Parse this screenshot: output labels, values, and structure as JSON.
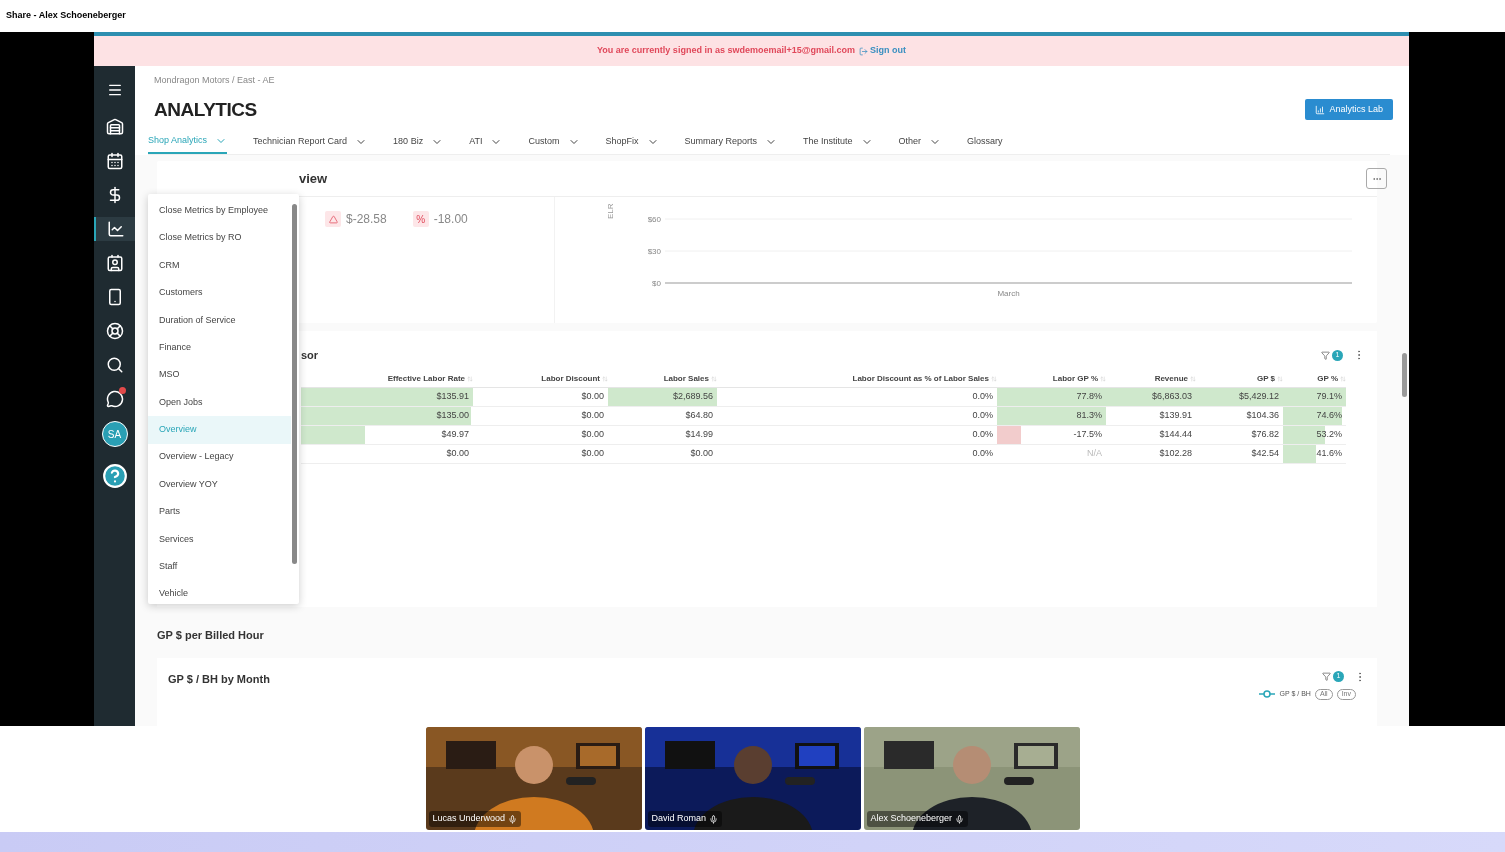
{
  "share_bar": {
    "title": "Share - Alex Schoeneberger"
  },
  "banner": {
    "message": "You are currently signed in as swdemoemail+15@gmail.com",
    "link": "Sign out"
  },
  "sidebar": {
    "items": [
      {
        "selected": false
      },
      {
        "selected": false
      },
      {
        "selected": false
      },
      {
        "selected": true
      },
      {
        "selected": false
      },
      {
        "selected": false
      },
      {
        "selected": false
      },
      {
        "selected": false
      },
      {
        "selected": false
      }
    ],
    "avatar": "SA"
  },
  "breadcrumb": "Mondragon Motors / East - AE",
  "title": "ANALYTICS",
  "lab_button": "Analytics Lab",
  "tabs": [
    {
      "label": "Shop Analytics",
      "selected": true,
      "dropdown": true
    },
    {
      "label": "Technician Report Card",
      "selected": false,
      "dropdown": true
    },
    {
      "label": "180 Biz",
      "selected": false,
      "dropdown": true
    },
    {
      "label": "ATI",
      "selected": false,
      "dropdown": true
    },
    {
      "label": "Custom",
      "selected": false,
      "dropdown": true
    },
    {
      "label": "ShopFix",
      "selected": false,
      "dropdown": true
    },
    {
      "label": "Summary Reports",
      "selected": false,
      "dropdown": true
    },
    {
      "label": "The Institute",
      "selected": false,
      "dropdown": true
    },
    {
      "label": "Other",
      "selected": false,
      "dropdown": true
    },
    {
      "label": "Glossary",
      "selected": false,
      "dropdown": false
    }
  ],
  "menu": {
    "items": [
      {
        "label": "Close Metrics by Employee",
        "selected": false
      },
      {
        "label": "Close Metrics by RO",
        "selected": false
      },
      {
        "label": "CRM",
        "selected": false
      },
      {
        "label": "Customers",
        "selected": false
      },
      {
        "label": "Duration of Service",
        "selected": false
      },
      {
        "label": "Finance",
        "selected": false
      },
      {
        "label": "MSO",
        "selected": false
      },
      {
        "label": "Open Jobs",
        "selected": false
      },
      {
        "label": "Overview",
        "selected": true
      },
      {
        "label": "Overview - Legacy",
        "selected": false
      },
      {
        "label": "Overview YOY",
        "selected": false
      },
      {
        "label": "Parts",
        "selected": false
      },
      {
        "label": "Services",
        "selected": false
      },
      {
        "label": "Staff",
        "selected": false
      },
      {
        "label": "Vehicle",
        "selected": false
      }
    ]
  },
  "overview": {
    "title": "view",
    "metrics": [
      {
        "kind": "delta",
        "value": "$-28.58"
      },
      {
        "kind": "percent",
        "icon_text": "%",
        "value": "-18.00"
      }
    ],
    "chart_data": {
      "type": "line",
      "ylabel": "ELR",
      "categories": [
        "March"
      ],
      "yticks": [
        {
          "value": 0,
          "label": "$0"
        },
        {
          "value": 30,
          "label": "$30"
        },
        {
          "value": 60,
          "label": "$60"
        }
      ],
      "ylim": [
        0,
        60
      ]
    }
  },
  "table": {
    "title": "sor",
    "filter_count": "1",
    "columns": [
      "Effective Labor Rate",
      "Labor Discount",
      "Labor Sales",
      "Labor Discount as % of Labor Sales",
      "Labor GP %",
      "Revenue",
      "GP $",
      "GP %"
    ],
    "rows": [
      {
        "cells": [
          {
            "text": "$135.91",
            "level": 1,
            "color": "#cfe8cc"
          },
          {
            "text": "$0.00"
          },
          {
            "text": "$2,689.56",
            "level": 1,
            "color": "#cfe8cc"
          },
          {
            "text": "0.0%"
          },
          {
            "text": "77.8%",
            "level": 1,
            "color": "#cfe8cc"
          },
          {
            "text": "$6,863.03",
            "level": 1,
            "color": "#cfe8cc"
          },
          {
            "text": "$5,429.12",
            "level": 1,
            "color": "#cfe8cc"
          },
          {
            "text": "79.1%",
            "level": 1,
            "color": "#cfe8cc"
          }
        ]
      },
      {
        "cells": [
          {
            "text": "$135.00",
            "level": 0.99,
            "color": "#cfe8cc"
          },
          {
            "text": "$0.00"
          },
          {
            "text": "$64.80"
          },
          {
            "text": "0.0%"
          },
          {
            "text": "81.3%",
            "level": 1,
            "color": "#cfe8cc"
          },
          {
            "text": "$139.91"
          },
          {
            "text": "$104.36"
          },
          {
            "text": "74.6%",
            "level": 0.94,
            "color": "#cfe8cc"
          }
        ]
      },
      {
        "cells": [
          {
            "text": "$49.97",
            "level": 0.37,
            "color": "#cfe8cc"
          },
          {
            "text": "$0.00"
          },
          {
            "text": "$14.99"
          },
          {
            "text": "0.0%"
          },
          {
            "text": "-17.5%",
            "level": 0.22,
            "color": "#f2cccc"
          },
          {
            "text": "$144.44"
          },
          {
            "text": "$76.82"
          },
          {
            "text": "53.2%",
            "level": 0.67,
            "color": "#cfe8cc"
          }
        ]
      },
      {
        "cells": [
          {
            "text": "$0.00"
          },
          {
            "text": "$0.00"
          },
          {
            "text": "$0.00"
          },
          {
            "text": "0.0%"
          },
          {
            "text": "N/A",
            "muted": true
          },
          {
            "text": "$102.28"
          },
          {
            "text": "$42.54"
          },
          {
            "text": "41.6%",
            "level": 0.52,
            "color": "#cfe8cc"
          }
        ]
      }
    ]
  },
  "gp_section": {
    "heading": "GP $ per Billed Hour",
    "card": {
      "title": "GP $ / BH by Month",
      "filter_count": "1",
      "legend": "GP $ / BH",
      "toggles": [
        "All",
        "Inv"
      ]
    }
  },
  "participants": [
    {
      "name": "Lucas Underwood",
      "kind": "warm"
    },
    {
      "name": "David Roman",
      "kind": "blue"
    },
    {
      "name": "Alex Schoeneberger",
      "kind": "wall"
    }
  ]
}
